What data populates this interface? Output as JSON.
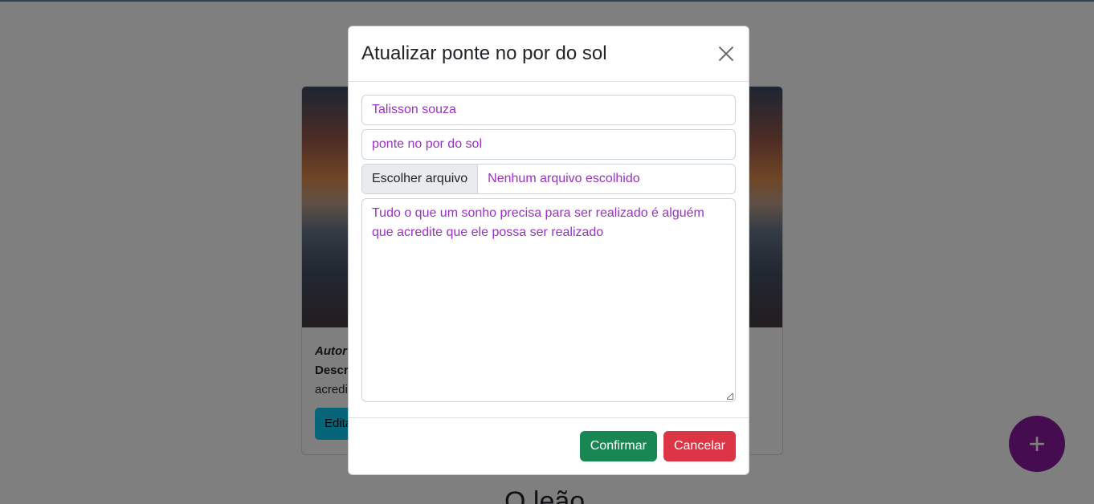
{
  "background": {
    "card": {
      "author_label": "Autor",
      "description_label": "Descr",
      "description_text": "acredi",
      "edit_button": "Edita"
    },
    "next_card_title": "O leão",
    "fab_label": "+"
  },
  "modal": {
    "title": "Atualizar ponte no por do sol",
    "author_value": "Talisson souza",
    "title_value": "ponte no por do sol",
    "file_button": "Escolher arquivo",
    "file_status": "Nenhum arquivo escolhido",
    "description_value": "Tudo o que um sonho precisa para ser realizado é alguém que acredite que ele possa ser realizado",
    "confirm_label": "Confirmar",
    "cancel_label": "Cancelar"
  },
  "colors": {
    "confirm": "#198754",
    "cancel": "#dc3545",
    "input_text": "#9b30c4",
    "fab": "#8a1aa0"
  }
}
